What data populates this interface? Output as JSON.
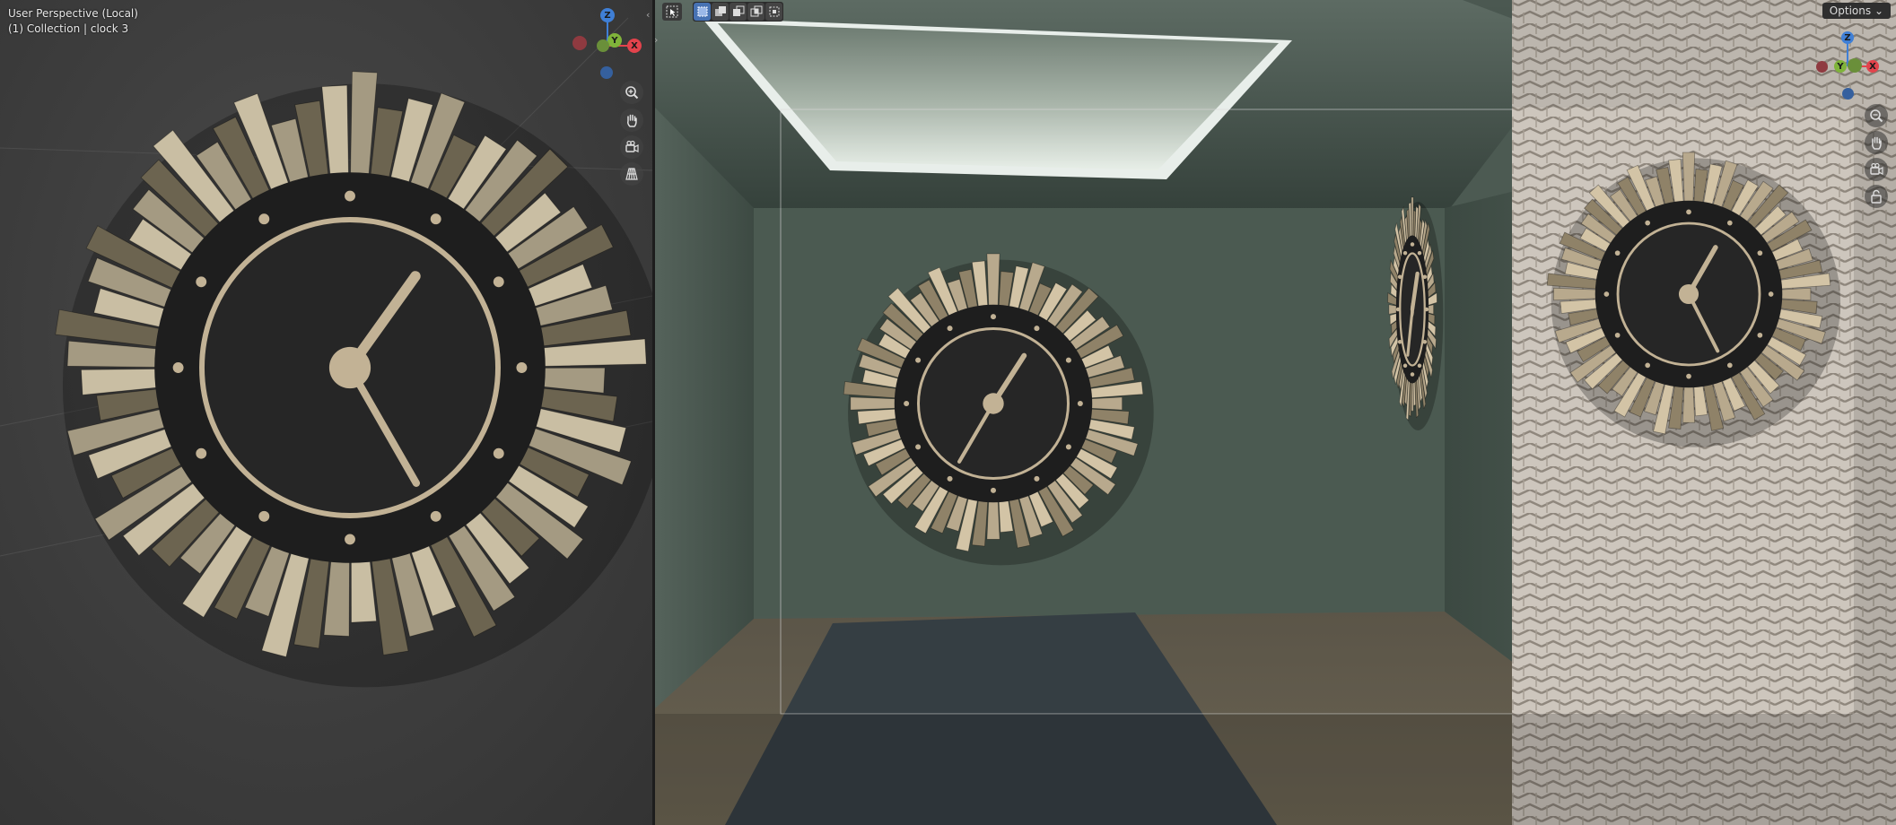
{
  "left_viewport": {
    "view_name": "User Perspective (Local)",
    "object_info": "(1) Collection | clock 3",
    "gizmo": {
      "z": "Z",
      "y": "Y",
      "x": "X"
    },
    "nav_icons": [
      "zoom-icon",
      "hand-pan-icon",
      "camera-view-icon",
      "perspective-grid-icon"
    ]
  },
  "right_viewport": {
    "options_label": "Options",
    "gizmo": {
      "z": "Z",
      "y": "Y",
      "x": "X"
    },
    "toolbar_icons": [
      "select-cursor-icon",
      "select-box-icon",
      "select-extend-icon",
      "select-subtract-icon",
      "select-intersect-icon"
    ],
    "nav_icons": [
      "zoom-icon",
      "hand-pan-icon",
      "camera-view-icon",
      "lock-camera-icon"
    ]
  },
  "colors": {
    "axis_x": "#e2434c",
    "axis_y": "#7fb33a",
    "axis_z": "#3f7fd6",
    "selection": "#4772b3",
    "wall_green": "#4c5a52"
  }
}
